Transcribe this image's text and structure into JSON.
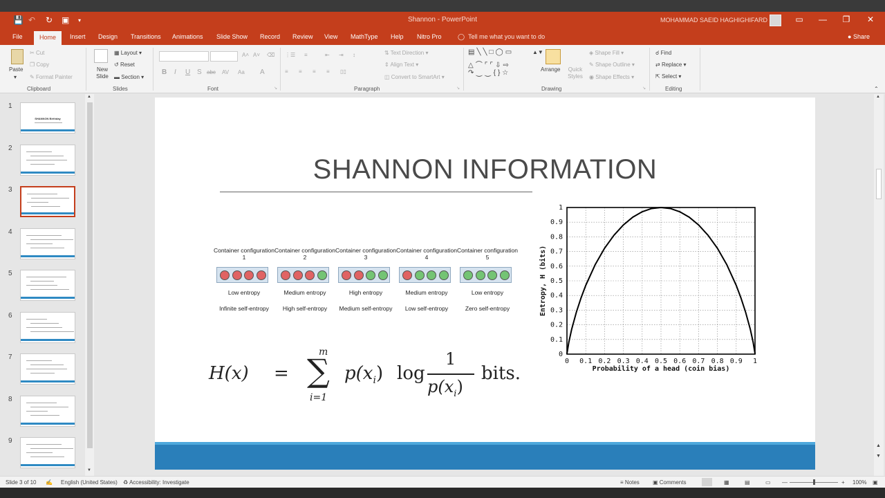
{
  "window": {
    "title": "Shannon - PowerPoint",
    "user": "MOHAMMAD SAEID HAGHIGHIFARD"
  },
  "tabs": [
    "File",
    "Home",
    "Insert",
    "Design",
    "Transitions",
    "Animations",
    "Slide Show",
    "Record",
    "Review",
    "View",
    "MathType",
    "Help",
    "Nitro Pro"
  ],
  "active_tab": "Home",
  "tell_me": "Tell me what you want to do",
  "share": "Share",
  "ribbon": {
    "clipboard": {
      "paste": "Paste",
      "cut": "Cut",
      "copy": "Copy",
      "format_painter": "Format Painter",
      "label": "Clipboard"
    },
    "slides": {
      "new_slide": "New Slide",
      "layout": "Layout",
      "reset": "Reset",
      "section": "Section",
      "label": "Slides"
    },
    "font": {
      "label": "Font",
      "bold": "B",
      "italic": "I",
      "underline": "U",
      "shadow": "S",
      "strike": "abc",
      "spacing": "AV",
      "case": "Aa",
      "color": "A"
    },
    "paragraph": {
      "text_direction": "Text Direction",
      "align_text": "Align Text",
      "convert": "Convert to SmartArt",
      "label": "Paragraph"
    },
    "drawing": {
      "arrange": "Arrange",
      "quick_styles": "Quick Styles",
      "shape_fill": "Shape Fill",
      "shape_outline": "Shape Outline",
      "shape_effects": "Shape Effects",
      "label": "Drawing"
    },
    "editing": {
      "find": "Find",
      "replace": "Replace",
      "select": "Select",
      "label": "Editing"
    }
  },
  "thumbnails": [
    {
      "num": "1",
      "title": "SHANNON Birthday"
    },
    {
      "num": "2",
      "title": ""
    },
    {
      "num": "3",
      "title": ""
    },
    {
      "num": "4",
      "title": ""
    },
    {
      "num": "5",
      "title": ""
    },
    {
      "num": "6",
      "title": ""
    },
    {
      "num": "7",
      "title": ""
    },
    {
      "num": "8",
      "title": ""
    },
    {
      "num": "9",
      "title": ""
    }
  ],
  "selected_slide": 3,
  "slide": {
    "title": "SHANNON INFORMATION",
    "containers": [
      {
        "label": "Container configuration 1",
        "balls": [
          "r",
          "r",
          "r",
          "r"
        ],
        "entropy": "Low entropy",
        "self": "Infinite self-entropy"
      },
      {
        "label": "Container configuration 2",
        "balls": [
          "r",
          "r",
          "r",
          "g"
        ],
        "entropy": "Medium entropy",
        "self": "High self-entropy"
      },
      {
        "label": "Container configuration 3",
        "balls": [
          "r",
          "r",
          "g",
          "g"
        ],
        "entropy": "High entropy",
        "self": "Medium self-entropy"
      },
      {
        "label": "Container configuration 4",
        "balls": [
          "r",
          "g",
          "g",
          "g"
        ],
        "entropy": "Medium entropy",
        "self": "Low self-entropy"
      },
      {
        "label": "Container configuration 5",
        "balls": [
          "g",
          "g",
          "g",
          "g"
        ],
        "entropy": "Low entropy",
        "self": "Zero self-entropy"
      }
    ],
    "formula": {
      "lhs": "H(x)",
      "eq": "=",
      "sum_top": "m",
      "sum_bottom": "i=1",
      "px": "p(x",
      "sub": "i",
      "close": ")",
      "log": "log",
      "num": "1",
      "den": "p(x",
      "unit": "bits."
    }
  },
  "chart_data": {
    "type": "line",
    "ylabel": "Entropy, H (bits)",
    "xlabel": "Probability of a head (coin bias)",
    "xlim": [
      0,
      1
    ],
    "ylim": [
      0,
      1
    ],
    "xticks": [
      "0",
      "0.1",
      "0.2",
      "0.3",
      "0.4",
      "0.5",
      "0.6",
      "0.7",
      "0.8",
      "0.9",
      "1"
    ],
    "yticks": [
      "0",
      "0.1",
      "0.2",
      "0.3",
      "0.4",
      "0.5",
      "0.6",
      "0.7",
      "0.8",
      "0.9",
      "1"
    ],
    "grid": true,
    "x": [
      0.001,
      0.01,
      0.025,
      0.05,
      0.075,
      0.1,
      0.15,
      0.2,
      0.25,
      0.3,
      0.35,
      0.4,
      0.45,
      0.5,
      0.55,
      0.6,
      0.65,
      0.7,
      0.75,
      0.8,
      0.85,
      0.9,
      0.925,
      0.95,
      0.975,
      0.99,
      0.999
    ],
    "y": [
      0.011,
      0.081,
      0.169,
      0.286,
      0.384,
      0.469,
      0.61,
      0.722,
      0.811,
      0.881,
      0.934,
      0.971,
      0.993,
      1.0,
      0.993,
      0.971,
      0.934,
      0.881,
      0.811,
      0.722,
      0.61,
      0.469,
      0.384,
      0.286,
      0.169,
      0.081,
      0.011
    ]
  },
  "status": {
    "slide_of": "Slide 3 of 10",
    "language": "English (United States)",
    "accessibility": "Accessibility: Investigate",
    "notes": "Notes",
    "comments": "Comments",
    "zoom": "100%"
  }
}
